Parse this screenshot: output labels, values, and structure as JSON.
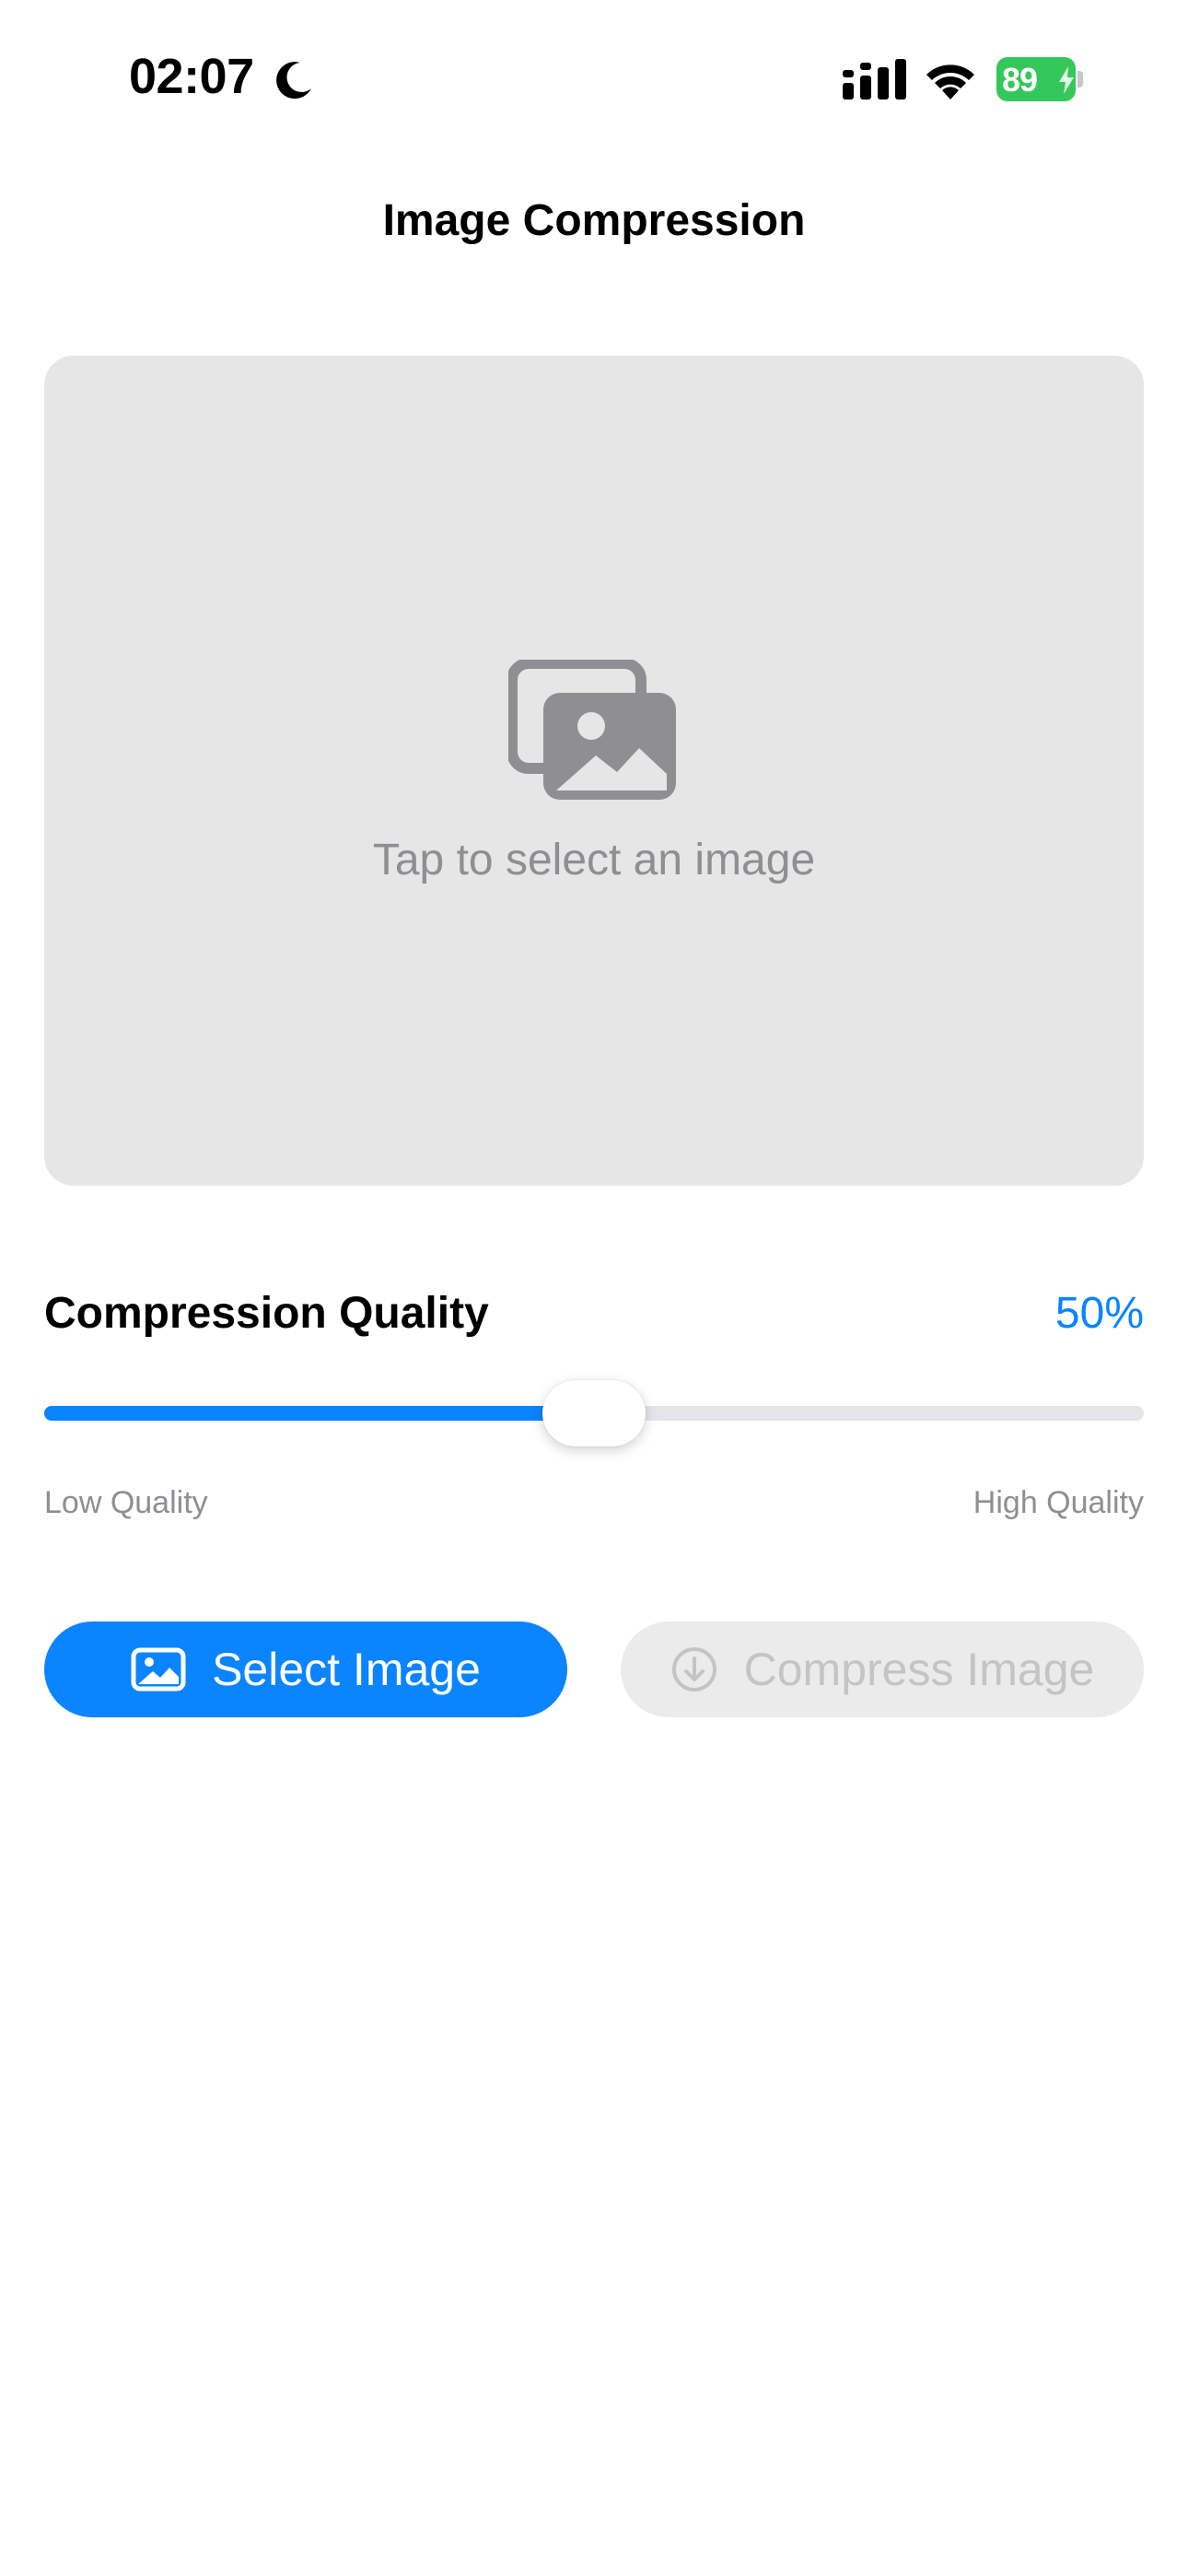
{
  "status_bar": {
    "time": "02:07",
    "battery_level": "89",
    "icons": [
      "moon-icon",
      "cellular-signal-icon",
      "wifi-icon",
      "battery-charging-icon"
    ]
  },
  "header": {
    "title": "Image Compression"
  },
  "image_picker": {
    "placeholder_text": "Tap to select an image",
    "icon": "photo-stack-icon"
  },
  "quality": {
    "label": "Compression Quality",
    "value_text": "50%",
    "value": 0.5,
    "min_label": "Low Quality",
    "max_label": "High Quality"
  },
  "actions": {
    "select_label": "Select Image",
    "select_icon": "photo-icon",
    "compress_label": "Compress Image",
    "compress_icon": "arrow-down-circle-icon",
    "compress_enabled": false
  },
  "colors": {
    "accent": "#0a84ff",
    "placeholder_bg": "#e6e6e6",
    "secondary_text": "#8e8e93",
    "battery": "#34c759",
    "disabled_bg": "#ebebeb",
    "disabled_text": "#c4c4c6"
  }
}
